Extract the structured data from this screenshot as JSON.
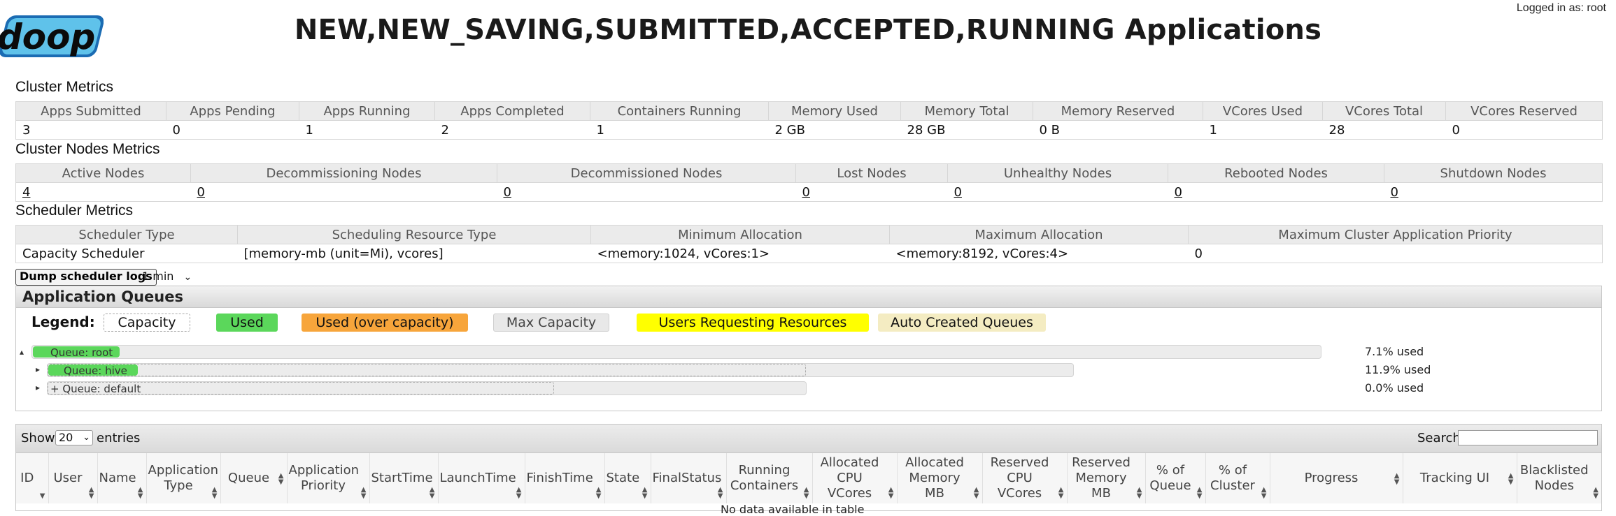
{
  "header": {
    "logo_text": "doop",
    "title": "NEW,NEW_SAVING,SUBMITTED,ACCEPTED,RUNNING Applications",
    "login_text": "Logged in as: root"
  },
  "cluster_metrics": {
    "title": "Cluster Metrics",
    "headers": [
      "Apps Submitted",
      "Apps Pending",
      "Apps Running",
      "Apps Completed",
      "Containers Running",
      "Memory Used",
      "Memory Total",
      "Memory Reserved",
      "VCores Used",
      "VCores Total",
      "VCores Reserved"
    ],
    "values": [
      "3",
      "0",
      "1",
      "2",
      "1",
      "2 GB",
      "28 GB",
      "0 B",
      "1",
      "28",
      "0"
    ]
  },
  "node_metrics": {
    "title": "Cluster Nodes Metrics",
    "headers": [
      "Active Nodes",
      "Decommissioning Nodes",
      "Decommissioned Nodes",
      "Lost Nodes",
      "Unhealthy Nodes",
      "Rebooted Nodes",
      "Shutdown Nodes"
    ],
    "values": [
      "4",
      "0",
      "0",
      "0",
      "0",
      "0",
      "0"
    ]
  },
  "scheduler_metrics": {
    "title": "Scheduler Metrics",
    "headers": [
      "Scheduler Type",
      "Scheduling Resource Type",
      "Minimum Allocation",
      "Maximum Allocation",
      "Maximum Cluster Application Priority"
    ],
    "values": [
      "Capacity Scheduler",
      "[memory-mb (unit=Mi), vcores]",
      "<memory:1024, vCores:1>",
      "<memory:8192, vCores:4>",
      "0"
    ]
  },
  "scheduler_logs": {
    "dump_label": "Dump scheduler logs",
    "interval": "1 min"
  },
  "queues": {
    "title": "Application Queues",
    "legend_label": "Legend:",
    "legend": {
      "capacity": "Capacity",
      "used": "Used",
      "over": "Used (over capacity)",
      "max": "Max Capacity",
      "users": "Users Requesting Resources",
      "auto": "Auto Created Queues"
    },
    "colors": {
      "used": "#5bd75b",
      "over": "#f7a53b",
      "max": "#e8e8e8",
      "users": "#ffff00",
      "auto": "#f4ecc2"
    },
    "items": [
      {
        "label": "Queue: root",
        "pct": "7.1% used",
        "used_fraction": 0.071
      },
      {
        "label": "Queue: hive",
        "pct": "11.9% used",
        "used_fraction": 0.119
      },
      {
        "label": "+ Queue: default",
        "pct": "0.0% used",
        "used_fraction": 0.0
      }
    ]
  },
  "apps_table": {
    "show_label": "Show",
    "entries_value": "20",
    "entries_label": "entries",
    "search_label": "Search:",
    "columns": [
      "ID",
      "User",
      "Name",
      "Application Type",
      "Queue",
      "Application Priority",
      "StartTime",
      "LaunchTime",
      "FinishTime",
      "State",
      "FinalStatus",
      "Running Containers",
      "Allocated CPU VCores",
      "Allocated Memory MB",
      "Reserved CPU VCores",
      "Reserved Memory MB",
      "% of Queue",
      "% of Cluster",
      "Progress",
      "Tracking UI",
      "Blacklisted Nodes"
    ],
    "empty_text": "No data available in table"
  }
}
